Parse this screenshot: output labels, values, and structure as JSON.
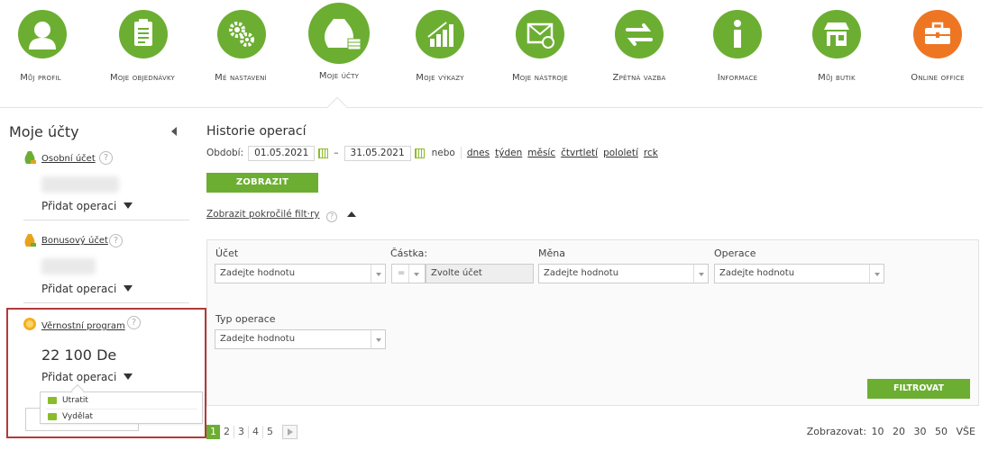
{
  "nav": {
    "items": [
      {
        "label": "Můj profil",
        "icon": "profile-icon",
        "color": "#6cae32"
      },
      {
        "label": "Moje objednávky",
        "icon": "clipboard-icon",
        "color": "#6cae32"
      },
      {
        "label": "Mé nastavení",
        "icon": "gears-icon",
        "color": "#6cae32"
      },
      {
        "label": "Moje účty",
        "icon": "money-bag-icon",
        "color": "#6cae32"
      },
      {
        "label": "Moje výkazy",
        "icon": "bar-chart-icon",
        "color": "#6cae32"
      },
      {
        "label": "Moje nástroje",
        "icon": "mail-tools-icon",
        "color": "#6cae32"
      },
      {
        "label": "Zpětná vazba",
        "icon": "arrows-icon",
        "color": "#6cae32"
      },
      {
        "label": "Informace",
        "icon": "info-icon",
        "color": "#6cae32"
      },
      {
        "label": "Můj butik",
        "icon": "shop-icon",
        "color": "#6cae32"
      },
      {
        "label": "Online office",
        "icon": "briefcase-icon",
        "color": "#ee7623"
      }
    ]
  },
  "sidebar": {
    "title": "Moje účty",
    "accounts": [
      {
        "name": "Osobní účet",
        "value": "",
        "action": "Přidat operaci"
      },
      {
        "name": "Bonusový účet",
        "value": "",
        "action": "Přidat operaci"
      },
      {
        "name": "Věrnostní program",
        "value": "22 100 De",
        "action": "Přidat operaci"
      }
    ],
    "help_glyph": "?",
    "dropdown": [
      "Utratit",
      "Vydělat"
    ]
  },
  "main": {
    "title": "Historie operací",
    "period_label": "Období:",
    "date_from": "01.05.2021",
    "date_to": "31.05.2021",
    "dash": "–",
    "or_label": "nebo",
    "quick": [
      "dnes",
      "týden",
      "měsíc",
      "čtvrtletí",
      "pololetí",
      "rck"
    ],
    "show_button": "ZOBRAZIT",
    "advanced_filters": "Zobrazit pokročilé filt·ry"
  },
  "filters": {
    "account_label": "Účet",
    "account_placeholder": "Zadejte hodnotu",
    "amount_label": "Částka:",
    "amount_op": "=",
    "amount_value": "Zvolte účet",
    "currency_label": "Měna",
    "currency_placeholder": "Zadejte hodnotu",
    "operation_label": "Operace",
    "operation_placeholder": "Zadejte hodnotu",
    "type_label": "Typ operace",
    "type_placeholder": "Zadejte hodnotu",
    "filter_button": "FILTROVAT"
  },
  "pagination": {
    "pages": [
      "1",
      "2",
      "3",
      "4",
      "5"
    ],
    "active": "1",
    "per_page_label": "Zobrazovat:",
    "per_page_options": [
      "10",
      "20",
      "30",
      "50",
      "VŠE"
    ]
  }
}
